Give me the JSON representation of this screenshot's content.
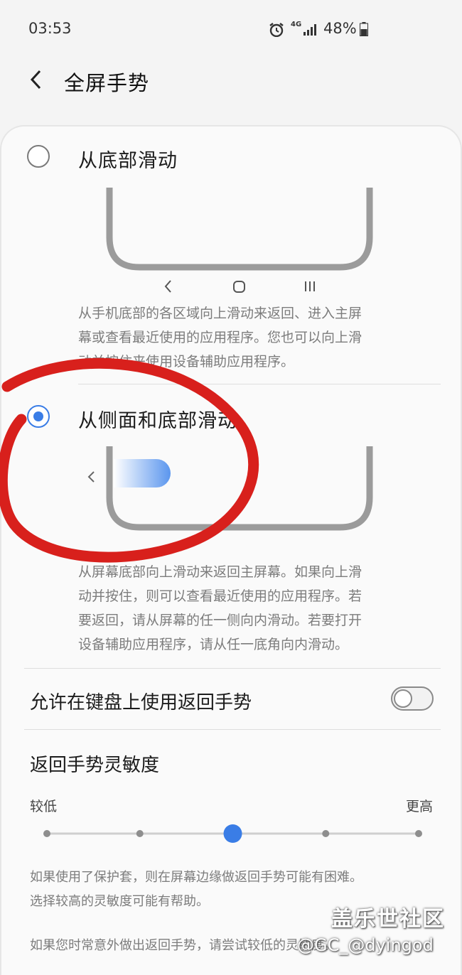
{
  "status_bar": {
    "time": "03:53",
    "network": "4G",
    "battery": "48%",
    "icons": [
      "alarm-icon",
      "network-4g-icon",
      "signal-icon",
      "battery-icon"
    ]
  },
  "header": {
    "back_icon": "chevron-left-icon",
    "title": "全屏手势"
  },
  "options": [
    {
      "label": "从底部滑动",
      "selected": false,
      "description_lines": [
        "从手机底部的各区域向上滑动来返回、进入主屏",
        "幕或查看最近使用的应用程序。您也可以向上滑",
        "动并按住来使用设备辅助应用程序。"
      ]
    },
    {
      "label": "从侧面和底部滑动",
      "selected": true,
      "description_lines": [
        "从屏幕底部向上滑动来返回主屏幕。如果向上滑",
        "动并按住，则可以查看最近使用的应用程序。若",
        "要返回，请从屏幕的任一侧向内滑动。若要打开",
        "设备辅助应用程序，请从任一底角向内滑动。"
      ]
    }
  ],
  "nav_icons": [
    "back-icon",
    "home-icon",
    "recents-icon"
  ],
  "keyboard_toggle": {
    "label": "允许在键盘上使用返回手势",
    "enabled": false
  },
  "sensitivity": {
    "title": "返回手势灵敏度",
    "low_label": "较低",
    "high_label": "更高",
    "steps": 5,
    "selected_step": 2
  },
  "notes": [
    [
      "如果使用了保护套，则在屏幕边缘做返回手势可能有困难。",
      "选择较高的灵敏度可能有帮助。"
    ],
    [
      "如果您时常意外做出返回手势，请尝试较低的灵敏度。"
    ]
  ],
  "watermark": {
    "title": "盖乐世社区",
    "handle": "@GC_@dyingod"
  },
  "colors": {
    "accent": "#3a7de6",
    "annotation": "#d8201c",
    "description": "#7c7c7c"
  }
}
